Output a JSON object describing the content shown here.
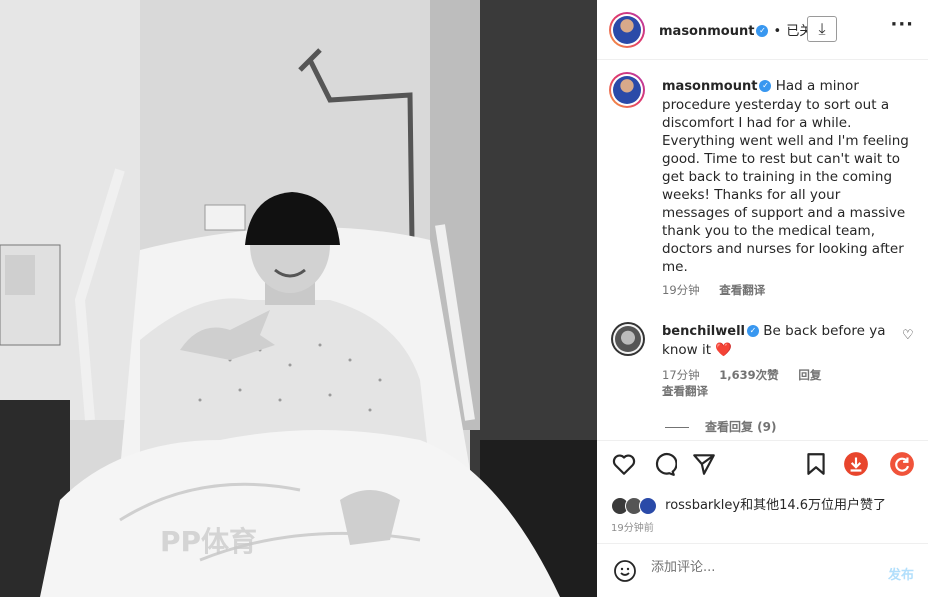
{
  "post": {
    "author": "masonmount",
    "follow_state": "已关",
    "separator": "•",
    "icons": {
      "verified": "verified-badge-icon",
      "download": "download-icon",
      "more": "more-options-icon"
    }
  },
  "caption": {
    "author": "masonmount",
    "text": "Had a minor procedure yesterday to sort out a discomfort I had for a while. Everything went well and I'm feeling good. Time to rest but can't wait to get back to training in the coming weeks! Thanks for all your messages of support and a massive thank you to the medical team, doctors and nurses for looking after me.",
    "time": "19分钟",
    "translate": "查看翻译"
  },
  "comment": {
    "author": "benchilwell",
    "text": "Be back before ya know it",
    "emoji": "❤️",
    "time": "17分钟",
    "likes": "1,639次赞",
    "reply": "回复",
    "translate": "查看翻译",
    "view_replies": "查看回复 (9)"
  },
  "actions": [
    "like-icon",
    "comment-icon",
    "share-icon",
    "save-icon",
    "download-extension-icon",
    "refresh-extension-icon"
  ],
  "likes": {
    "text": "rossbarkley和其他14.6万位用户赞了"
  },
  "time_ago": "19分钟前",
  "add_comment": {
    "placeholder": "添加评论...",
    "post_label": "发布"
  },
  "watermark": "PP体育",
  "colors": {
    "accent": "#0095f6",
    "verified": "#3897f0",
    "heart": "#ed4956",
    "download_ext": "#e8452c",
    "refresh_ext": "#f0533a"
  }
}
